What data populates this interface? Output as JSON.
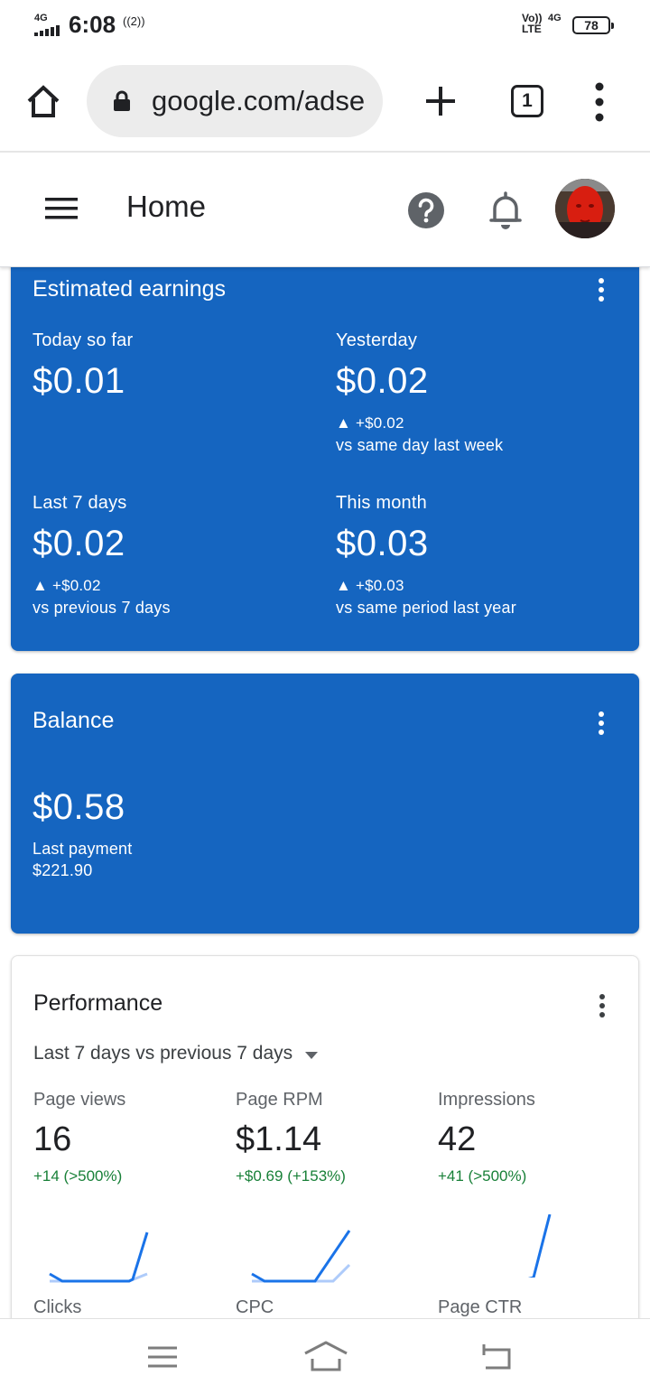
{
  "status_bar": {
    "network": "4G",
    "time": "6:08",
    "hotspot": "((2))",
    "volte": "Vo)) LTE",
    "network_right": "4G",
    "battery": "78"
  },
  "browser": {
    "url": "google.com/adse",
    "tab_count": "1"
  },
  "header": {
    "title": "Home"
  },
  "earnings": {
    "title": "Estimated earnings",
    "today": {
      "label": "Today so far",
      "value": "$0.01"
    },
    "yesterday": {
      "label": "Yesterday",
      "value": "$0.02",
      "change": "▲ +$0.02",
      "compare": "vs same day last week"
    },
    "last7": {
      "label": "Last 7 days",
      "value": "$0.02",
      "change": "▲ +$0.02",
      "compare": "vs previous 7 days"
    },
    "month": {
      "label": "This month",
      "value": "$0.03",
      "change": "▲ +$0.03",
      "compare": "vs same period last year"
    }
  },
  "balance": {
    "title": "Balance",
    "value": "$0.58",
    "last_payment_label": "Last payment",
    "last_payment_value": "$221.90"
  },
  "performance": {
    "title": "Performance",
    "range": "Last 7 days vs previous 7 days",
    "metrics": [
      {
        "label": "Page views",
        "value": "16",
        "delta": "+14 (>500%)"
      },
      {
        "label": "Page RPM",
        "value": "$1.14",
        "delta": "+$0.69 (+153%)"
      },
      {
        "label": "Impressions",
        "value": "42",
        "delta": "+41 (>500%)"
      }
    ],
    "next_metrics": [
      "Clicks",
      "CPC",
      "Page CTR"
    ]
  },
  "colors": {
    "card_blue": "#1565c0",
    "positive_green": "#188038",
    "spark_current": "#1a73e8",
    "spark_previous": "#aecbfa"
  }
}
